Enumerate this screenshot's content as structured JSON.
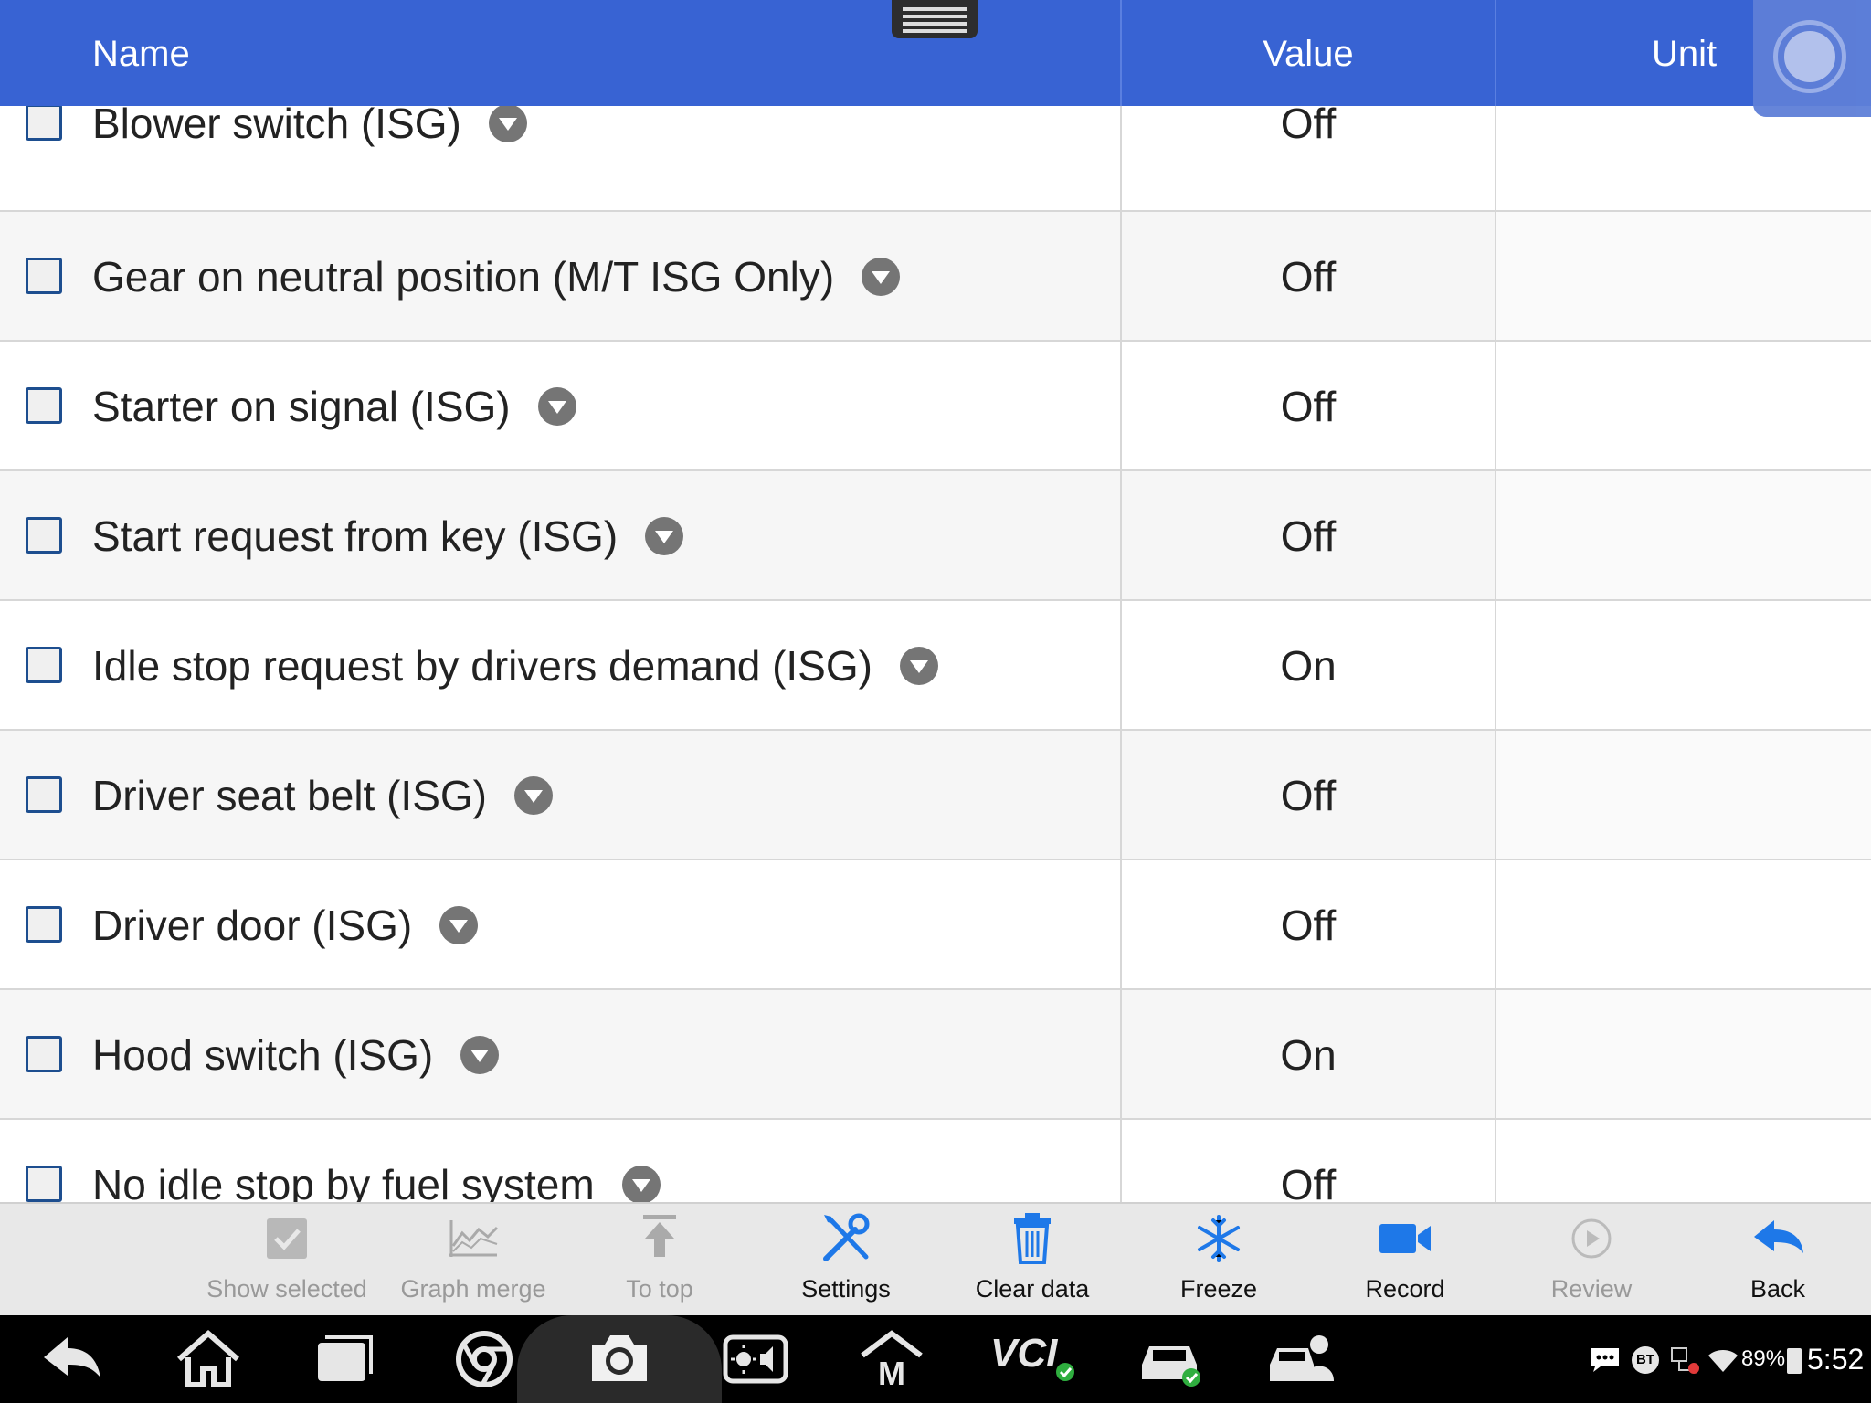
{
  "header": {
    "name": "Name",
    "value": "Value",
    "unit": "Unit"
  },
  "rows": [
    {
      "name": "Blower switch (ISG)",
      "value": "Off",
      "unit": ""
    },
    {
      "name": "Gear on neutral position (M/T ISG Only)",
      "value": "Off",
      "unit": ""
    },
    {
      "name": "Starter on signal (ISG)",
      "value": "Off",
      "unit": ""
    },
    {
      "name": "Start request from key (ISG)",
      "value": "Off",
      "unit": ""
    },
    {
      "name": "Idle stop request by drivers demand (ISG)",
      "value": "On",
      "unit": ""
    },
    {
      "name": "Driver seat belt (ISG)",
      "value": "Off",
      "unit": ""
    },
    {
      "name": "Driver door (ISG)",
      "value": "Off",
      "unit": ""
    },
    {
      "name": "Hood switch (ISG)",
      "value": "On",
      "unit": ""
    },
    {
      "name": "No idle stop by fuel system",
      "value": "Off",
      "unit": ""
    }
  ],
  "toolbar": {
    "show_selected": "Show selected",
    "graph_merge": "Graph merge",
    "to_top": "To top",
    "settings": "Settings",
    "clear_data": "Clear data",
    "freeze": "Freeze",
    "record": "Record",
    "review": "Review",
    "back": "Back"
  },
  "status": {
    "battery": "89%",
    "time": "5:52",
    "bt": "BT"
  },
  "nav": {
    "vci": "VCI",
    "m": "M"
  },
  "colors": {
    "header": "#3863d3",
    "accent": "#1e78e8",
    "checkbox": "#1d4e8f"
  }
}
